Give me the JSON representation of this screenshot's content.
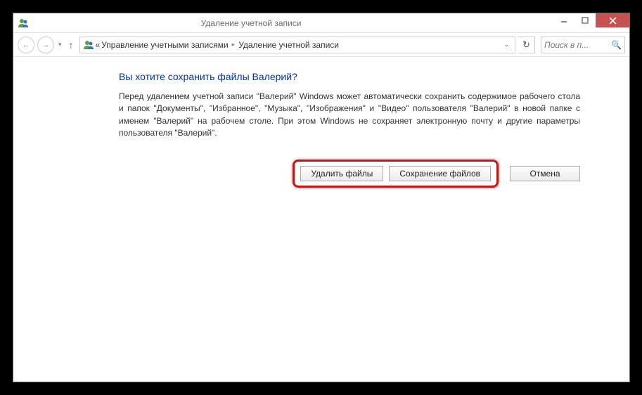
{
  "titlebar": {
    "title": "Удаление учетной записи"
  },
  "nav": {
    "crumb_prefix": "«",
    "crumb1": "Управление учетными записями",
    "crumb2": "Удаление учетной записи",
    "search_placeholder": "Поиск в п..."
  },
  "main": {
    "heading": "Вы хотите сохранить файлы Валерий?",
    "body": "Перед удалением учетной записи \"Валерий\" Windows может автоматически сохранить содержимое рабочего стола и папок \"Документы\", \"Избранное\", \"Музыка\", \"Изображения\" и \"Видео\" пользователя \"Валерий\" в новой папке с именем \"Валерий\" на рабочем столе. При этом Windows не сохраняет электронную почту и другие параметры пользователя \"Валерий\"."
  },
  "buttons": {
    "delete": "Удалить файлы",
    "save": "Сохранение файлов",
    "cancel": "Отмена"
  }
}
